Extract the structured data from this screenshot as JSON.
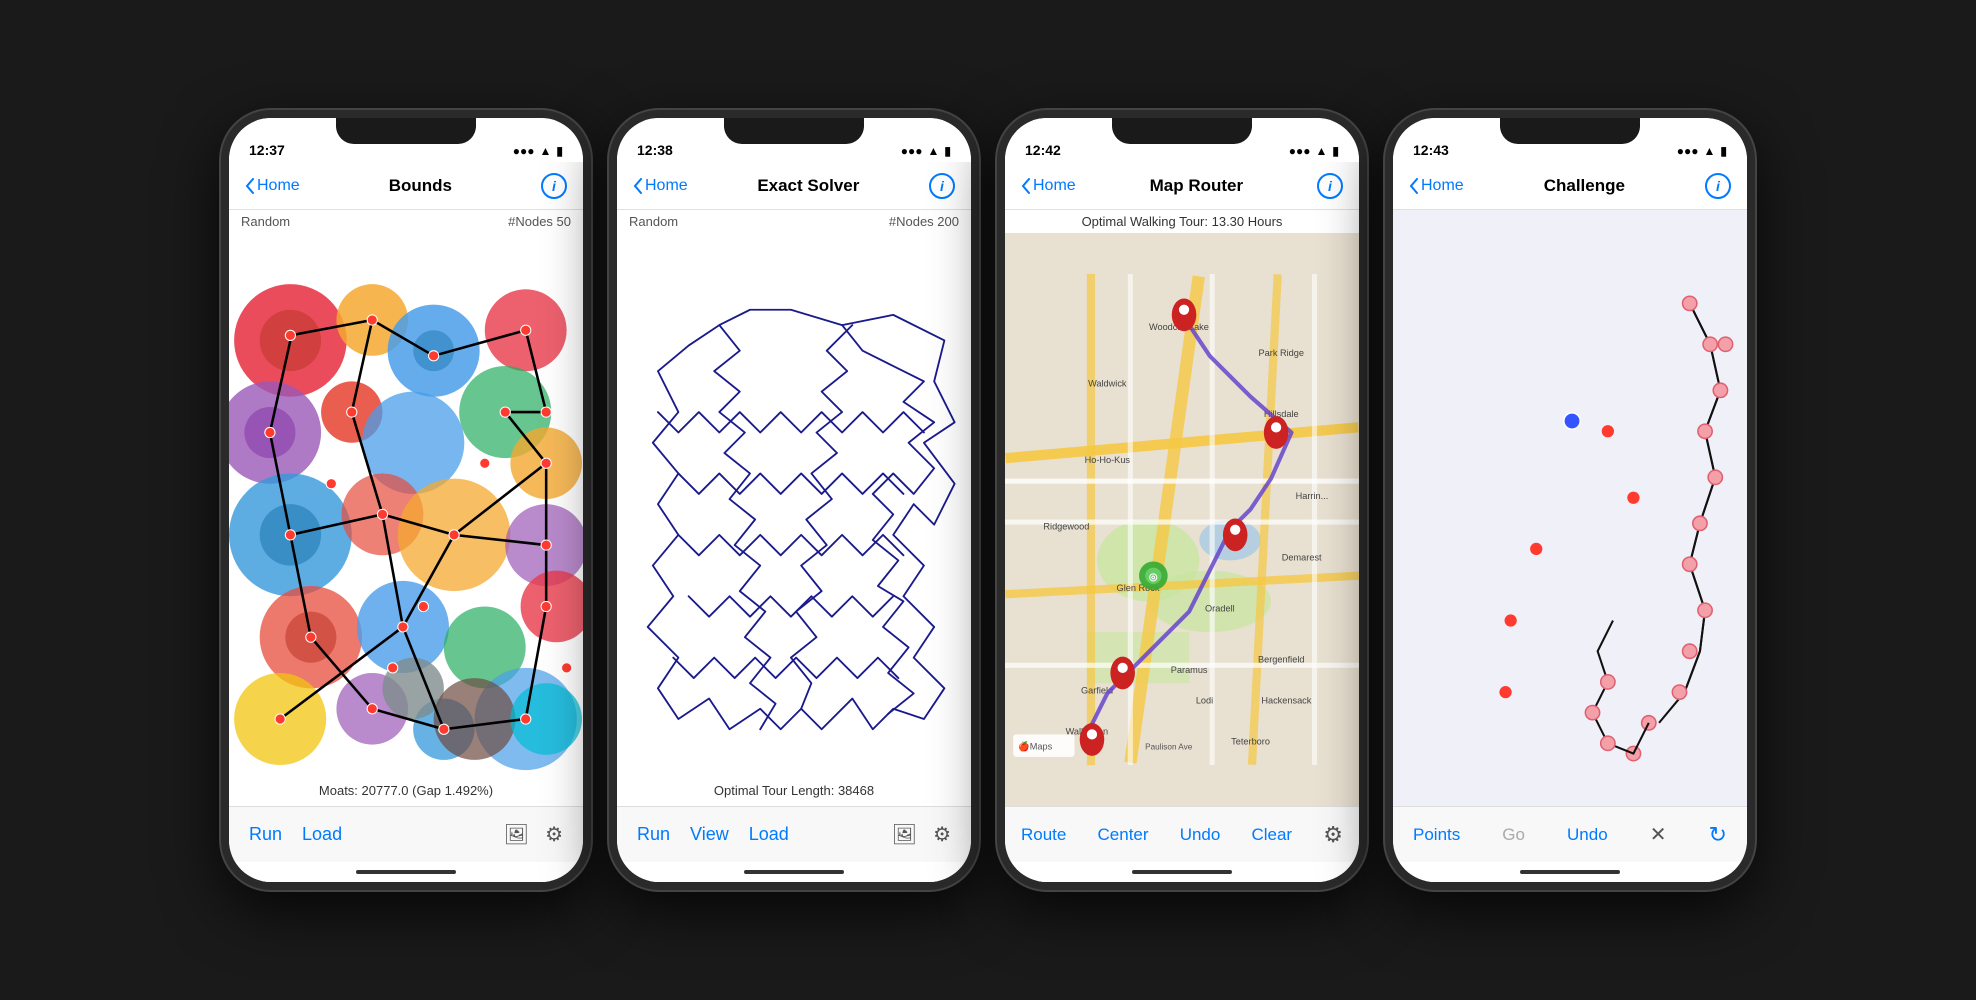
{
  "phones": [
    {
      "id": "bounds",
      "statusTime": "12:37",
      "navBack": "Home",
      "navTitle": "Bounds",
      "metaLeft": "Random",
      "metaRight": "#Nodes 50",
      "bottomCaption": "Moats: 20777.0 (Gap 1.492%)",
      "bottomActions": [
        "Run",
        "Load"
      ],
      "type": "bounds"
    },
    {
      "id": "solver",
      "statusTime": "12:38",
      "navBack": "Home",
      "navTitle": "Exact Solver",
      "metaLeft": "Random",
      "metaRight": "#Nodes 200",
      "bottomCaption": "Optimal Tour Length: 38468",
      "bottomActions": [
        "Run",
        "View",
        "Load"
      ],
      "type": "solver"
    },
    {
      "id": "maprouter",
      "statusTime": "12:42",
      "navBack": "Home",
      "navTitle": "Map Router",
      "mapInfo": "Optimal Walking Tour: 13.30 Hours",
      "bottomActions": [
        "Route",
        "Center",
        "Undo",
        "Clear"
      ],
      "type": "map"
    },
    {
      "id": "challenge",
      "statusTime": "12:43",
      "navBack": "Home",
      "navTitle": "Challenge",
      "bottomActions": [
        "Points",
        "Go",
        "Undo"
      ],
      "type": "challenge"
    }
  ]
}
